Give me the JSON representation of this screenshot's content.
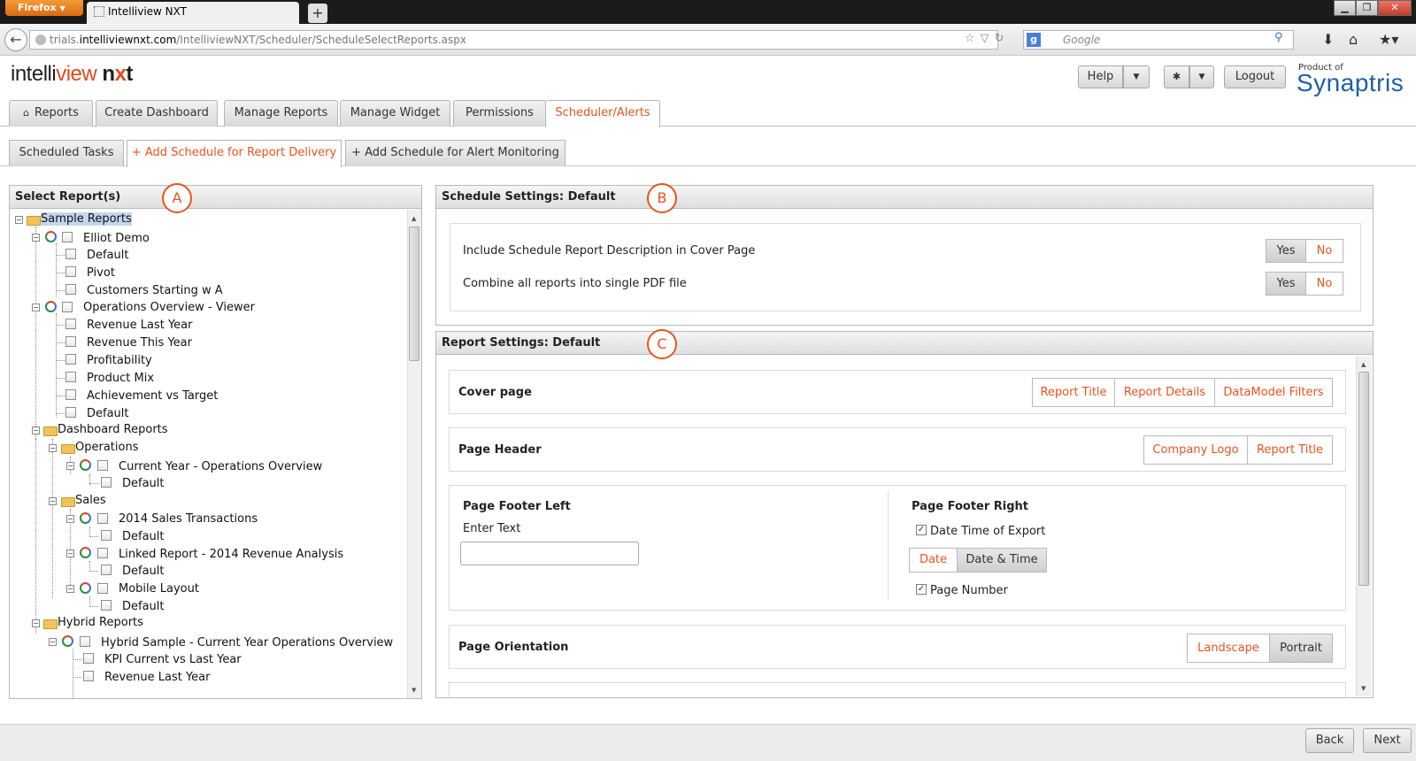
{
  "browser": {
    "app_button": "Firefox",
    "tab_title": "Intelliview NXT",
    "new_tab": "+",
    "url_prefix": "trials.",
    "url_host": "intelliviewnxt.com",
    "url_path": "/IntelliviewNXT/Scheduler/ScheduleSelectReports.aspx",
    "search_placeholder": "Google"
  },
  "header": {
    "logo_part1": "intelli",
    "logo_part2": "view",
    "logo_part3": "n",
    "logo_part4": "x",
    "logo_part5": "t",
    "help_label": "Help",
    "logout_label": "Logout",
    "product_of": "Product of",
    "company": "Synaptris"
  },
  "main_tabs": {
    "reports": "Reports",
    "create_dashboard": "Create Dashboard",
    "manage_reports": "Manage Reports",
    "manage_widget": "Manage Widget",
    "permissions": "Permissions",
    "scheduler": "Scheduler/Alerts"
  },
  "sub_tabs": {
    "scheduled": "Scheduled Tasks",
    "report_delivery": "+ Add Schedule for Report Delivery",
    "alert": "+ Add Schedule for Alert Monitoring"
  },
  "select_reports": {
    "title": "Select Report(s)",
    "badge": "A",
    "tree": [
      "Sample Reports",
      "Elliot Demo",
      "Default",
      "Pivot",
      "Customers Starting w A",
      "Operations Overview - Viewer",
      "Revenue Last Year",
      "Revenue This Year",
      "Profitability",
      "Product Mix",
      "Achievement vs Target",
      "Default",
      "Dashboard Reports",
      "Operations",
      "Current Year - Operations Overview",
      "Default",
      "Sales",
      "2014 Sales Transactions",
      "Default",
      "Linked Report - 2014 Revenue Analysis",
      "Default",
      "Mobile Layout",
      "Default",
      "Hybrid Reports",
      "Hybrid Sample - Current Year Operations Overview",
      "KPI Current vs Last Year",
      "Revenue Last Year"
    ]
  },
  "schedule_settings": {
    "title": "Schedule Settings: Default",
    "badge": "B",
    "rows": [
      {
        "label": "Include Schedule Report Description in Cover Page",
        "yes": "Yes",
        "no": "No"
      },
      {
        "label": "Combine all reports into single PDF file",
        "yes": "Yes",
        "no": "No"
      }
    ]
  },
  "report_settings": {
    "title": "Report Settings: Default",
    "badge": "C",
    "cover_page": {
      "title": "Cover page",
      "options": [
        "Report Title",
        "Report Details",
        "DataModel Filters"
      ]
    },
    "page_header": {
      "title": "Page Header",
      "options": [
        "Company Logo",
        "Report Title"
      ]
    },
    "footer_left": {
      "title": "Page Footer Left",
      "label": "Enter Text",
      "value": ""
    },
    "footer_right": {
      "title": "Page Footer Right",
      "date_time_label": "Date Time of Export",
      "date_label": "Date",
      "datetime_label": "Date & Time",
      "page_number_label": "Page Number"
    },
    "orientation": {
      "title": "Page Orientation",
      "landscape": "Landscape",
      "portrait": "Portrait"
    }
  },
  "footer_buttons": {
    "back": "Back",
    "next": "Next"
  },
  "colors": {
    "accent": "#e9531f",
    "brand": "#1f5fa8"
  }
}
